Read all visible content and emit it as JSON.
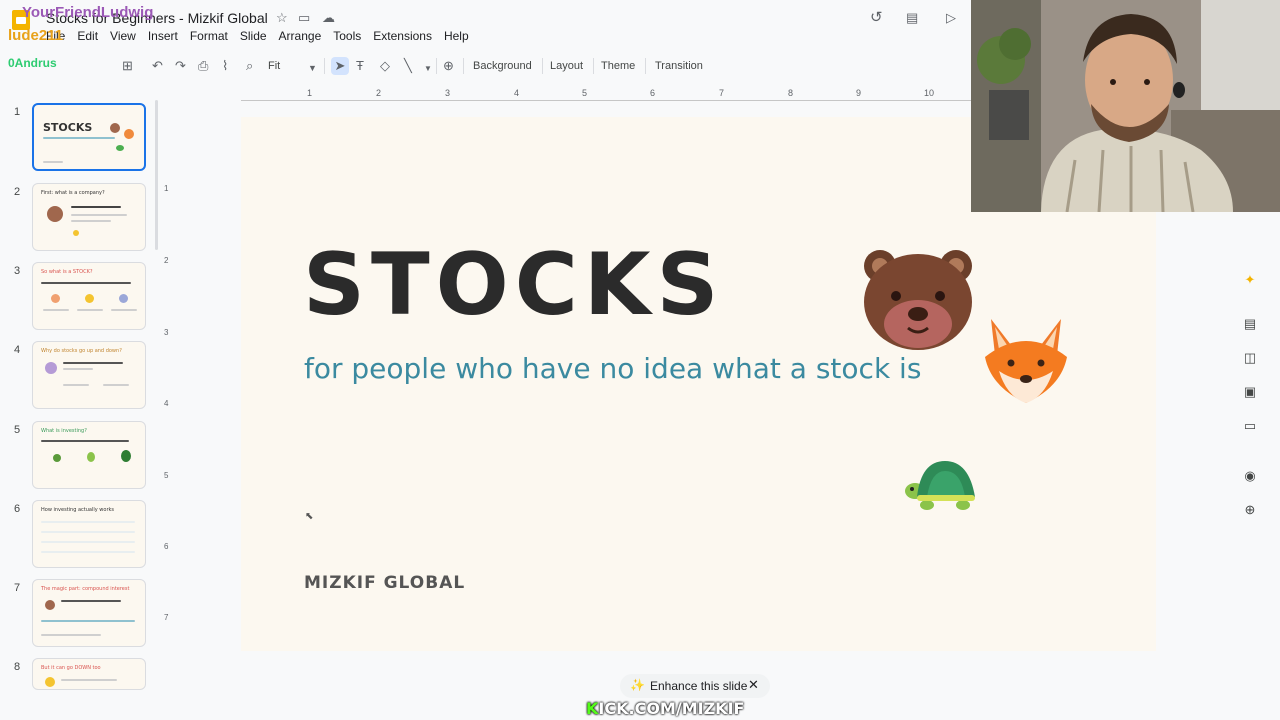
{
  "app": {
    "doc_title": "Stocks for Beginners - Mizkif Global"
  },
  "menu": {
    "items": [
      "File",
      "Edit",
      "View",
      "Insert",
      "Format",
      "Slide",
      "Arrange",
      "Tools",
      "Extensions",
      "Help"
    ]
  },
  "toolbar": {
    "zoom_label": "Fit",
    "background_label": "Background",
    "layout_label": "Layout",
    "theme_label": "Theme",
    "transition_label": "Transition"
  },
  "filmstrip": {
    "slides": [
      {
        "num": "1",
        "title": "STOCKS"
      },
      {
        "num": "2",
        "title": "First: what is a company?"
      },
      {
        "num": "3",
        "title": "So what is a STOCK?"
      },
      {
        "num": "4",
        "title": "Why do stocks go up and down?"
      },
      {
        "num": "5",
        "title": "What is investing?"
      },
      {
        "num": "6",
        "title": "How investing actually works"
      },
      {
        "num": "7",
        "title": "The magic part: compound interest"
      },
      {
        "num": "8",
        "title": "But it can go DOWN too"
      }
    ]
  },
  "ruler": {
    "h_numbers": [
      "1",
      "2",
      "3",
      "4",
      "5",
      "6",
      "7",
      "8",
      "9",
      "10"
    ],
    "v_numbers": [
      "1",
      "2",
      "3",
      "4",
      "5",
      "6",
      "7"
    ]
  },
  "slide": {
    "title": "STOCKS",
    "subtitle": "for people who have no idea what a stock is",
    "footer": "MIZKIF GLOBAL"
  },
  "icons": {
    "bear": "bear-emoji",
    "fox": "fox-emoji",
    "turtle": "turtle-emoji"
  },
  "overlay": {
    "name_a": "YourFriendLudwig",
    "name_b": "lude211",
    "name_c": "0Andrus"
  },
  "enhance": {
    "label": "Enhance this slide"
  },
  "stream_url": {
    "prefix": "K",
    "rest": "ICK.COM/MIZKIF"
  },
  "colors": {
    "slide_bg": "#fcf8f0",
    "subtitle": "#3b8aa0",
    "accent": "#1a73e8"
  }
}
